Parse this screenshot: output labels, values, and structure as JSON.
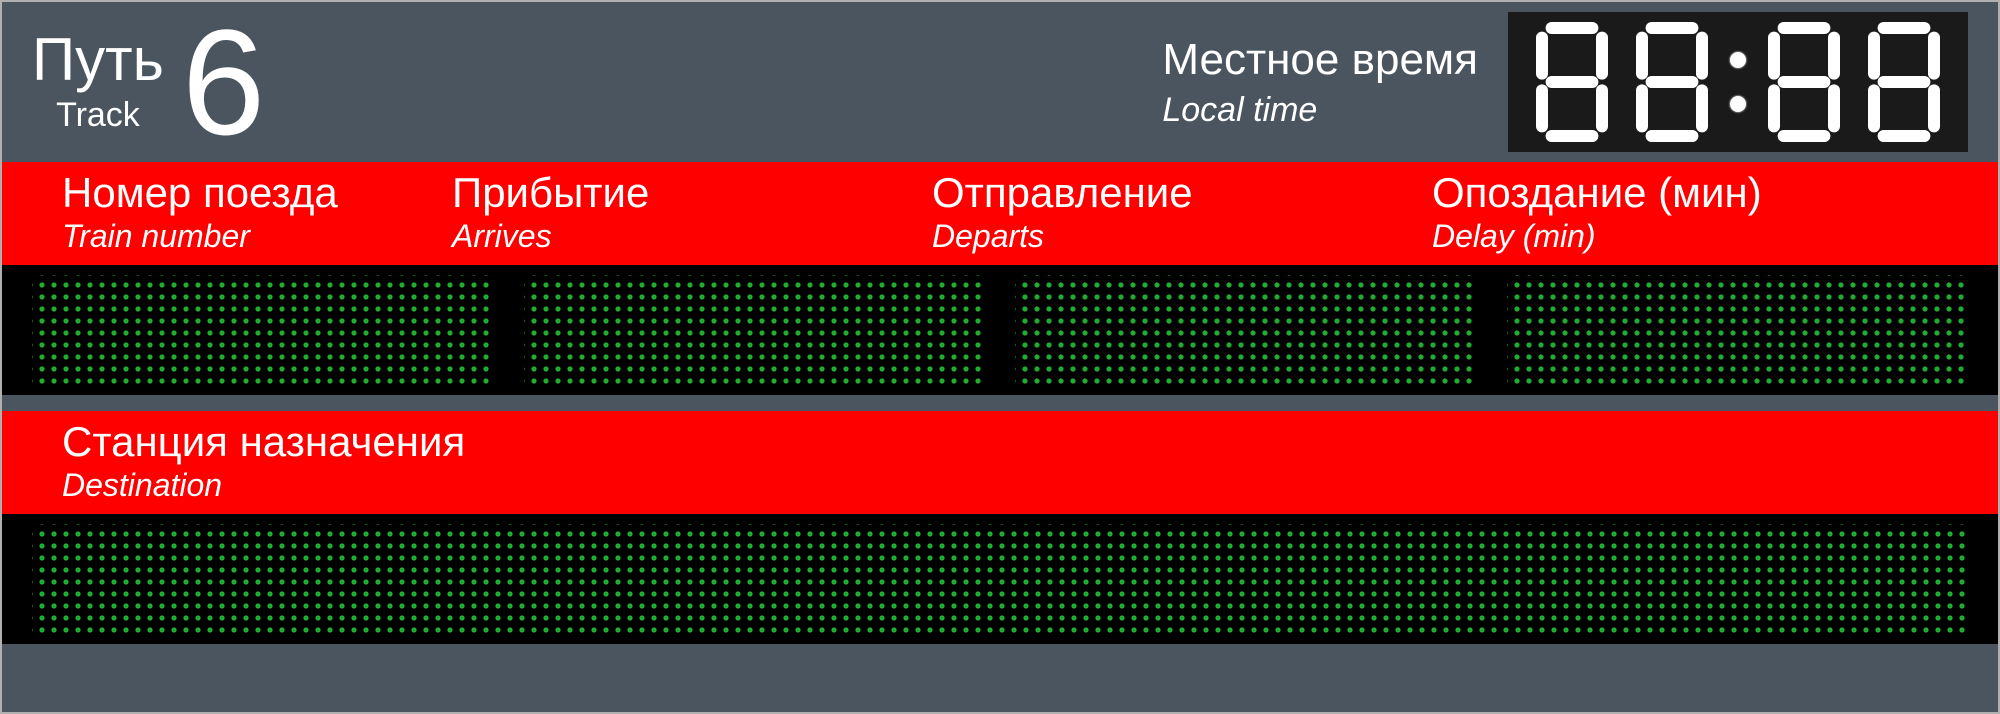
{
  "header": {
    "track_label_ru": "Путь",
    "track_label_en": "Track",
    "track_number": "6",
    "localtime_ru": "Местное время",
    "localtime_en": "Local time",
    "clock_value": "88:88"
  },
  "columns": {
    "train_number_ru": "Номер поезда",
    "train_number_en": "Train number",
    "arrives_ru": "Прибытие",
    "arrives_en": "Arrives",
    "departs_ru": "Отправление",
    "departs_en": "Departs",
    "delay_ru": "Опоздание (мин)",
    "delay_en": "Delay (min)"
  },
  "destination": {
    "label_ru": "Станция назначения",
    "label_en": "Destination"
  },
  "led_values": {
    "train_number": "",
    "arrives": "",
    "departs": "",
    "delay": "",
    "destination": ""
  },
  "colors": {
    "panel_bg": "#4a5560",
    "accent": "#ff0000",
    "led_green": "#1fae2f",
    "clock_bg": "#1a1a1a"
  }
}
